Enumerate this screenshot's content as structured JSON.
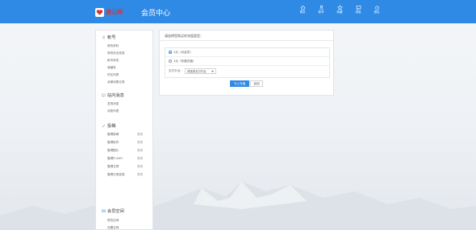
{
  "header": {
    "logo_text": "速云网",
    "title": "会员中心",
    "nav": [
      {
        "label": "首页",
        "icon": "home-icon"
      },
      {
        "label": "帐号",
        "icon": "user-icon"
      },
      {
        "label": "收藏",
        "icon": "star-icon"
      },
      {
        "label": "消息",
        "icon": "message-icon"
      },
      {
        "label": "退出",
        "icon": "power-icon"
      }
    ]
  },
  "sidebar": {
    "groups": [
      {
        "title": "帐号",
        "icon": "user-icon",
        "links": [
          "修改资料",
          "修改安全信息",
          "帐号状态",
          "收藏夹",
          "好友列表",
          "余额消费记录"
        ]
      },
      {
        "title": "站内消息",
        "icon": "message-icon",
        "links": [
          "发短消息",
          "消息列表"
        ]
      },
      {
        "title": "投稿",
        "icon": "pencil-icon",
        "links": [
          "管理新闻",
          "管理软件",
          "管理图片",
          "管理FLASH",
          "管理文章",
          "管理分类信息"
        ],
        "secondary": [
          "发布",
          "发布",
          "发布",
          "发布",
          "发布",
          "发布"
        ]
      },
      {
        "title": "会员空间",
        "icon": "space-icon",
        "links": [
          "预览空间",
          "设置空间"
        ]
      }
    ]
  },
  "panel": {
    "heading": "请选择您购买的充值类型：",
    "options": [
      {
        "label": "1元（月会员）",
        "selected": true
      },
      {
        "label": "1元（年度充值）",
        "selected": false
      }
    ],
    "pay_label": "支付平台：",
    "pay_select": "请选择支付平台",
    "submit_label": "马上充值",
    "back_label": "返回"
  },
  "colors": {
    "accent": "#2f8ae6",
    "logo_red": "#d83434"
  }
}
